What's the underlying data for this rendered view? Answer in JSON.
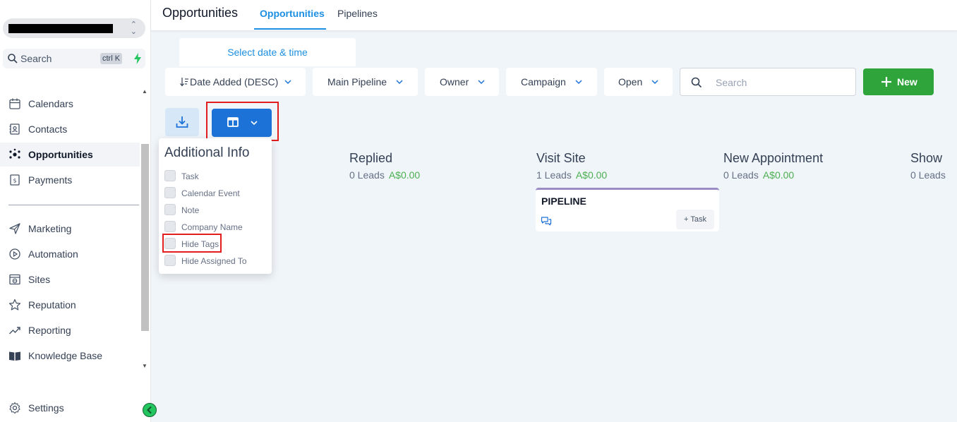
{
  "sidebar": {
    "search_label": "Search",
    "search_shortcut": "ctrl K",
    "items": [
      {
        "label": "Calendars",
        "icon": "calendar-icon"
      },
      {
        "label": "Contacts",
        "icon": "contacts-icon"
      },
      {
        "label": "Opportunities",
        "icon": "opportunities-icon",
        "active": true
      },
      {
        "label": "Payments",
        "icon": "payments-icon"
      },
      {
        "label": "Marketing",
        "icon": "send-icon"
      },
      {
        "label": "Automation",
        "icon": "automation-icon"
      },
      {
        "label": "Sites",
        "icon": "sites-icon"
      },
      {
        "label": "Reputation",
        "icon": "star-icon"
      },
      {
        "label": "Reporting",
        "icon": "trend-icon"
      },
      {
        "label": "Knowledge Base",
        "icon": "book-icon"
      }
    ],
    "settings_label": "Settings"
  },
  "header": {
    "title": "Opportunities",
    "tabs": [
      {
        "label": "Opportunities",
        "active": true
      },
      {
        "label": "Pipelines",
        "active": false
      }
    ]
  },
  "date_picker_label": "Select date & time",
  "filters": {
    "sort": "Date Added (DESC)",
    "pipeline": "Main Pipeline",
    "owner": "Owner",
    "campaign": "Campaign",
    "status": "Open",
    "search_placeholder": "Search",
    "new_label": "New"
  },
  "additional_info": {
    "title": "Additional Info",
    "options": [
      "Task",
      "Calendar Event",
      "Note",
      "Company Name",
      "Hide Tags",
      "Hide Assigned To"
    ]
  },
  "stages": [
    {
      "name": "Replied",
      "leads": "0 Leads",
      "amount": "A$0.00"
    },
    {
      "name": "Visit Site",
      "leads": "1 Leads",
      "amount": "A$0.00"
    },
    {
      "name": "New Appointment",
      "leads": "0 Leads",
      "amount": "A$0.00"
    },
    {
      "name": "Show",
      "leads": "0 Leads",
      "amount": ""
    }
  ],
  "card": {
    "title": "PIPELINE",
    "task_label": "+ Task"
  },
  "colors": {
    "accent": "#1d8fe1",
    "primary_button": "#1d72d8",
    "new_button": "#2ea43b",
    "amount": "#4caf50",
    "highlight": "#e11d1d"
  }
}
